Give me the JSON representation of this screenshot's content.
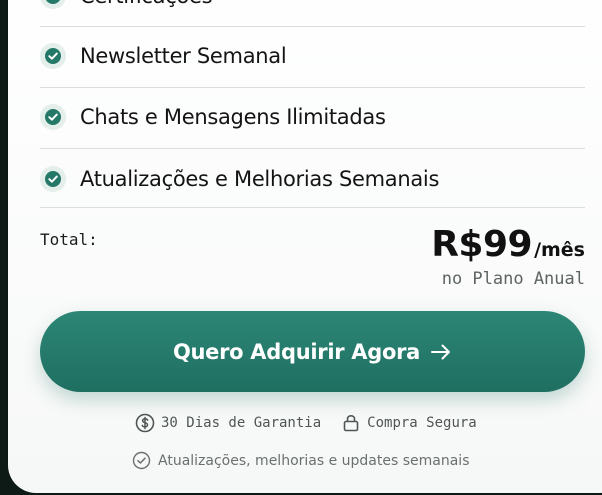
{
  "features": [
    {
      "label": "Certificações"
    },
    {
      "label": "Newsletter Semanal"
    },
    {
      "label": "Chats e Mensagens Ilimitadas"
    },
    {
      "label": "Atualizações e Melhorias Semanais"
    }
  ],
  "pricing": {
    "total_label": "Total:",
    "price": "R$99",
    "period": "/mês",
    "plan_note": "no Plano Anual"
  },
  "cta": {
    "label": "Quero Adquirir Agora",
    "icon": "arrow-right-icon"
  },
  "guarantees": {
    "money_back": "30 Dias de Garantia",
    "secure": "Compra Segura",
    "updates": "Atualizações, melhorias e updates semanais"
  },
  "colors": {
    "accent": "#237868",
    "check_bg": "#e4eeea",
    "text": "#141414",
    "muted": "#5d6461"
  }
}
